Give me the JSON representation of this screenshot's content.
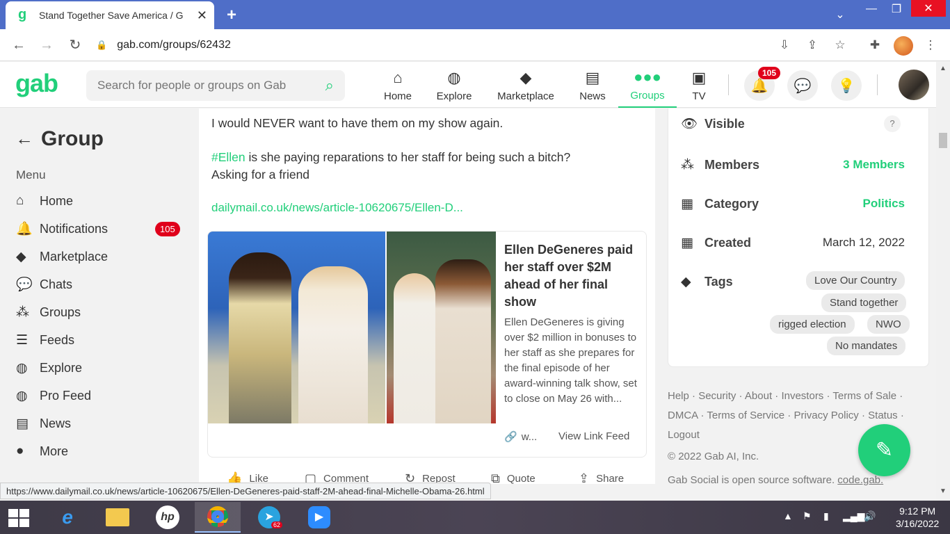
{
  "browser": {
    "tab_title": "Stand Together Save America / G",
    "tab_favicon": "g",
    "url": "gab.com/groups/62432",
    "status_url": "https://www.dailymail.co.uk/news/article-10620675/Ellen-DeGeneres-paid-staff-2M-ahead-final-Michelle-Obama-26.html"
  },
  "gab": {
    "logo": "gab",
    "search_placeholder": "Search for people or groups on Gab",
    "nav": [
      {
        "label": "Home",
        "icon": "home-icon"
      },
      {
        "label": "Explore",
        "icon": "globe-icon"
      },
      {
        "label": "Marketplace",
        "icon": "tag-icon"
      },
      {
        "label": "News",
        "icon": "newspaper-icon"
      },
      {
        "label": "Groups",
        "icon": "users-icon"
      },
      {
        "label": "TV",
        "icon": "tv-icon"
      }
    ],
    "notification_count": "105",
    "accent": "#21cf7a"
  },
  "sidebar": {
    "title": "Group",
    "menu_label": "Menu",
    "items": [
      {
        "label": "Home",
        "icon": "home-icon"
      },
      {
        "label": "Notifications",
        "icon": "bell-icon",
        "badge": "105"
      },
      {
        "label": "Marketplace",
        "icon": "tag-icon"
      },
      {
        "label": "Chats",
        "icon": "chat-icon"
      },
      {
        "label": "Groups",
        "icon": "users-icon"
      },
      {
        "label": "Feeds",
        "icon": "list-icon"
      },
      {
        "label": "Explore",
        "icon": "globe-icon"
      },
      {
        "label": "Pro Feed",
        "icon": "globe-icon"
      },
      {
        "label": "News",
        "icon": "newspaper-icon"
      },
      {
        "label": "More",
        "icon": "more-icon"
      }
    ]
  },
  "post": {
    "line1": "I would NEVER want to have them on my show again.",
    "hashtag": "#Ellen",
    "line2_rest": " is she paying reparations to her staff for being such a bitch?",
    "line3": "Asking for a friend",
    "link": "dailymail.co.uk/news/article-10620675/Ellen-D...",
    "card": {
      "title": "Ellen DeGeneres paid her staff over $2M ahead of her final show",
      "description": "Ellen DeGeneres is giving over $2 million in bonuses to her staff as she prepares for the final episode of her award-winning talk show, set to close on May 26 with...",
      "domain_short": "w...",
      "view_link": "View Link Feed"
    },
    "actions": {
      "like": "Like",
      "comment": "Comment",
      "repost": "Repost",
      "quote": "Quote",
      "share": "Share"
    }
  },
  "group_info": {
    "visible_label": "Visible",
    "visible_help": "?",
    "members_label": "Members",
    "members_value": "3 Members",
    "category_label": "Category",
    "category_value": "Politics",
    "created_label": "Created",
    "created_value": "March 12, 2022",
    "tags_label": "Tags",
    "tags": [
      "Love Our Country",
      "Stand together",
      "rigged election",
      "NWO",
      "No mandates"
    ]
  },
  "footer": {
    "links": [
      "Help",
      "Security",
      "About",
      "Investors",
      "Terms of Sale",
      "DMCA",
      "Terms of Service",
      "Privacy Policy",
      "Status",
      "Logout"
    ],
    "copyright": "© 2022 Gab AI, Inc.",
    "open_source": "Gab Social is open source software.",
    "open_source_link": "code.gab."
  },
  "taskbar": {
    "time": "9:12 PM",
    "date": "3/16/2022",
    "telegram_badge": "62"
  }
}
